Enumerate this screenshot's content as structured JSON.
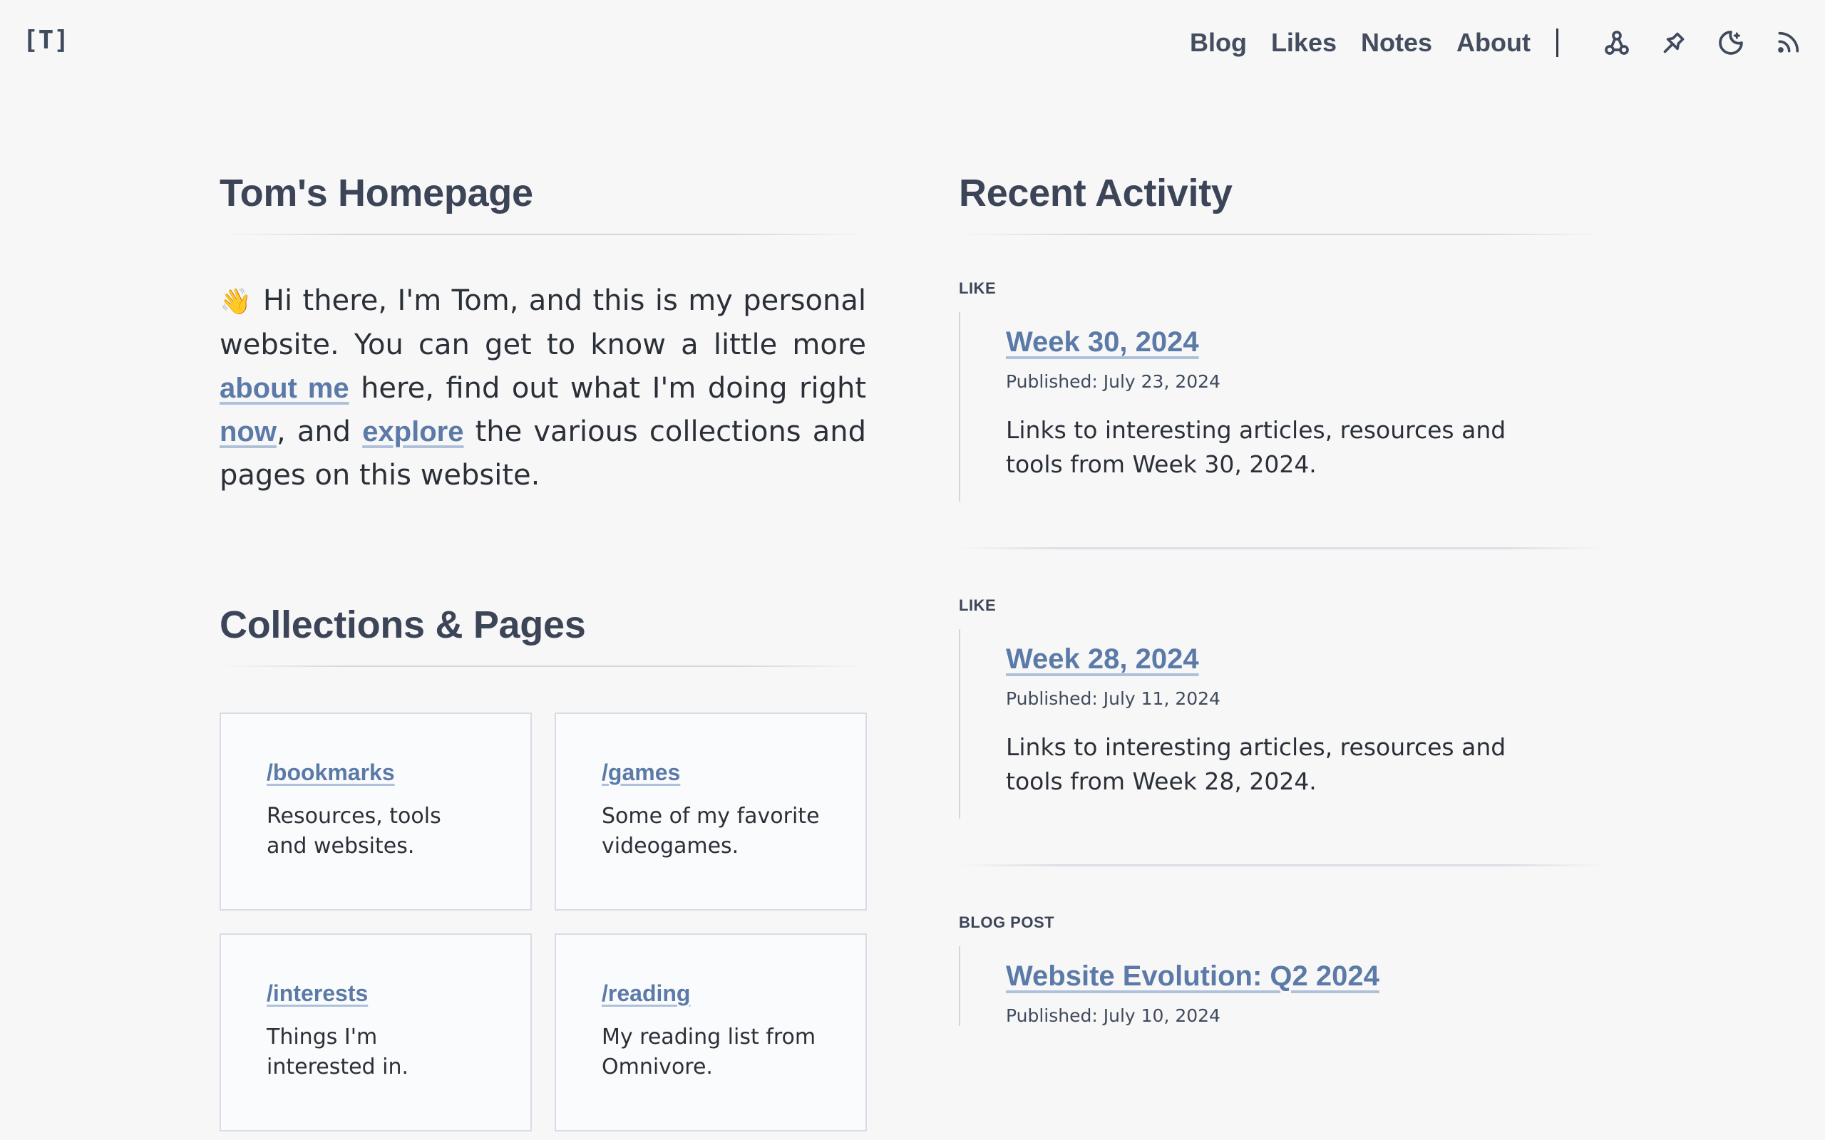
{
  "header": {
    "logo": "[T]",
    "nav": [
      {
        "label": "Blog"
      },
      {
        "label": "Likes"
      },
      {
        "label": "Notes"
      },
      {
        "label": "About"
      }
    ],
    "icons": [
      "sitemap-icon",
      "pin-icon",
      "moon-icon",
      "rss-icon"
    ]
  },
  "home": {
    "title": "Tom's Homepage",
    "wave": "👋",
    "intro_1": " Hi there, I'm Tom, and this is my personal website. You can get to know a little more ",
    "link_about": "about me",
    "intro_2": " here, find out what I'm doing right ",
    "link_now": "now",
    "intro_3": ", and ",
    "link_explore": "explore",
    "intro_4": " the various collections and pages on this website."
  },
  "collections": {
    "title": "Collections & Pages",
    "cards": [
      {
        "link": "/bookmarks",
        "desc": "Resources, tools and websites."
      },
      {
        "link": "/games",
        "desc": "Some of my favorite videogames."
      },
      {
        "link": "/interests",
        "desc": "Things I'm interested in."
      },
      {
        "link": "/reading",
        "desc": "My reading list from Omnivore."
      }
    ]
  },
  "activity": {
    "title": "Recent Activity",
    "items": [
      {
        "tag": "LIKE",
        "title": "Week 30, 2024",
        "date": "Published: July 23, 2024",
        "summary": "Links to interesting articles, resources and tools from Week 30, 2024."
      },
      {
        "tag": "LIKE",
        "title": "Week 28, 2024",
        "date": "Published: July 11, 2024",
        "summary": "Links to interesting articles, resources and tools from Week 28, 2024."
      },
      {
        "tag": "BLOG POST",
        "title": "Website Evolution: Q2 2024",
        "date": "Published: July 10, 2024",
        "summary": ""
      }
    ]
  },
  "colors": {
    "background": "#f7f7f8",
    "heading": "#3c4557",
    "link": "#5b7aa8",
    "text": "#2b3038"
  }
}
